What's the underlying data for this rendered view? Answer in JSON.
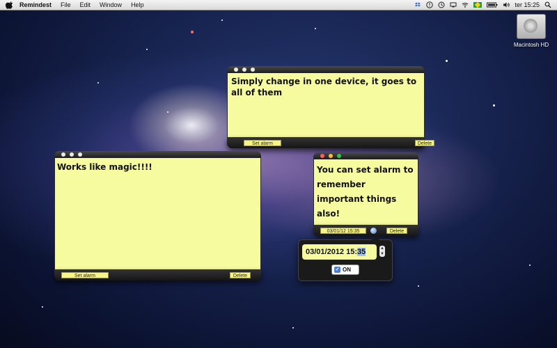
{
  "menubar": {
    "app_name": "Remindest",
    "menus": [
      "File",
      "Edit",
      "Window",
      "Help"
    ],
    "clock": "ter 15:25",
    "icons": [
      "dropbox-icon",
      "alert-icon",
      "time-machine-icon",
      "display-icon",
      "wifi-icon",
      "brazil-flag-icon",
      "battery-icon",
      "volume-icon",
      "spotlight-icon"
    ]
  },
  "desktop": {
    "drive_label": "Macintosh HD"
  },
  "notes": [
    {
      "text": "Simply change in one device, it goes to all of them",
      "set_alarm_label": "Set alarm",
      "delete_label": "Delete",
      "background": "#f7fba0"
    },
    {
      "text": "Works like magic!!!!",
      "set_alarm_label": "Set alarm",
      "delete_label": "Delete",
      "background": "#f7fba0"
    },
    {
      "text": "You can set alarm to remember important things also!",
      "alarm_time_label": "03/01/12 15:35",
      "delete_label": "Delete",
      "background": "#f7fba0"
    }
  ],
  "alarm_popover": {
    "date_prefix": "03/01/2012 15:",
    "date_selected": "35",
    "toggle_label": "ON",
    "toggle_checked": true
  },
  "colors": {
    "note_yellow": "#f7fba0",
    "button_yellow": "#f7f48a",
    "selection_blue": "#9fc2f2"
  }
}
